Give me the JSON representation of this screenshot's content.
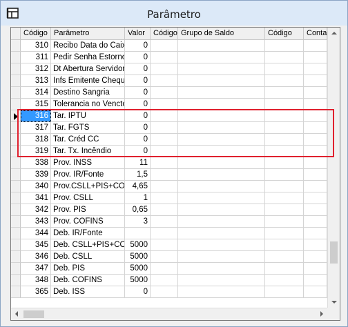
{
  "window": {
    "title": "Parâmetro",
    "icon": "table-app-icon"
  },
  "grid": {
    "columns": [
      "Código",
      "Parâmetro",
      "Valor",
      "Código",
      "Grupo de Saldo",
      "Código",
      "Conta"
    ],
    "selected_code": "316",
    "highlighted_codes": [
      "316",
      "317",
      "318",
      "319"
    ],
    "rows": [
      {
        "codigo": "310",
        "parametro": "Recibo Data do Caixa",
        "valor": "0"
      },
      {
        "codigo": "311",
        "parametro": "Pedir Senha Estorno",
        "valor": "0"
      },
      {
        "codigo": "312",
        "parametro": "Dt Abertura Servidor",
        "valor": "0"
      },
      {
        "codigo": "313",
        "parametro": "Infs Emitente Cheque",
        "valor": "0"
      },
      {
        "codigo": "314",
        "parametro": "Destino Sangria",
        "valor": "0"
      },
      {
        "codigo": "315",
        "parametro": "Tolerancia no Vencto",
        "valor": "0"
      },
      {
        "codigo": "316",
        "parametro": "Tar. IPTU",
        "valor": "0"
      },
      {
        "codigo": "317",
        "parametro": "Tar. FGTS",
        "valor": "0"
      },
      {
        "codigo": "318",
        "parametro": "Tar. Créd CC",
        "valor": "0"
      },
      {
        "codigo": "319",
        "parametro": "Tar. Tx. Incêndio",
        "valor": "0"
      },
      {
        "codigo": "338",
        "parametro": "Prov. INSS",
        "valor": "11"
      },
      {
        "codigo": "339",
        "parametro": "Prov. IR/Fonte",
        "valor": "1,5"
      },
      {
        "codigo": "340",
        "parametro": "Prov.CSLL+PIS+COFI",
        "valor": "4,65"
      },
      {
        "codigo": "341",
        "parametro": "Prov. CSLL",
        "valor": "1"
      },
      {
        "codigo": "342",
        "parametro": "Prov. PIS",
        "valor": "0,65"
      },
      {
        "codigo": "343",
        "parametro": "Prov. COFINS",
        "valor": "3"
      },
      {
        "codigo": "344",
        "parametro": "Deb. IR/Fonte",
        "valor": ""
      },
      {
        "codigo": "345",
        "parametro": "Deb. CSLL+PIS+COFI",
        "valor": "5000"
      },
      {
        "codigo": "346",
        "parametro": "Deb. CSLL",
        "valor": "5000"
      },
      {
        "codigo": "347",
        "parametro": "Deb. PIS",
        "valor": "5000"
      },
      {
        "codigo": "348",
        "parametro": "Deb. COFINS",
        "valor": "5000"
      },
      {
        "codigo": "365",
        "parametro": "Deb. ISS",
        "valor": "0"
      }
    ]
  },
  "colors": {
    "selection": "#3399ff",
    "highlight_border": "#e0202e"
  }
}
